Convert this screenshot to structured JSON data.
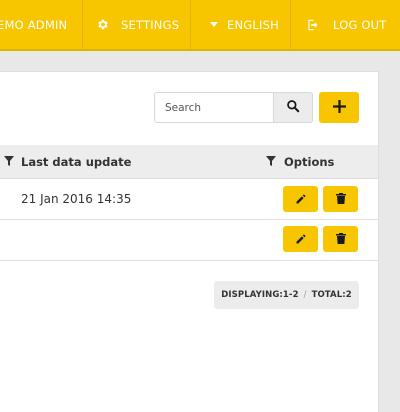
{
  "topbar": {
    "user_label": "EMO ADMIN",
    "settings_label": "SETTINGS",
    "language_label": "ENGLISH",
    "logout_label": "LOG OUT"
  },
  "toolbar": {
    "search_placeholder": "Search"
  },
  "table": {
    "columns": [
      "Last data update",
      "Options"
    ],
    "rows": [
      {
        "last_data_update": "21 Jan 2016 14:35"
      },
      {
        "last_data_update": ""
      }
    ]
  },
  "pager": {
    "displaying_label": "DISPLAYING:",
    "displaying_value": "1-2",
    "separator": "/",
    "total_label": "TOTAL:",
    "total_value": "2"
  },
  "colors": {
    "accent": "#f7c600",
    "icon_dark": "#1a1a1a"
  },
  "icons": [
    "gear-icon",
    "caret-down-icon",
    "logout-icon",
    "search-icon",
    "plus-icon",
    "filter-icon",
    "pencil-icon",
    "trash-icon"
  ]
}
